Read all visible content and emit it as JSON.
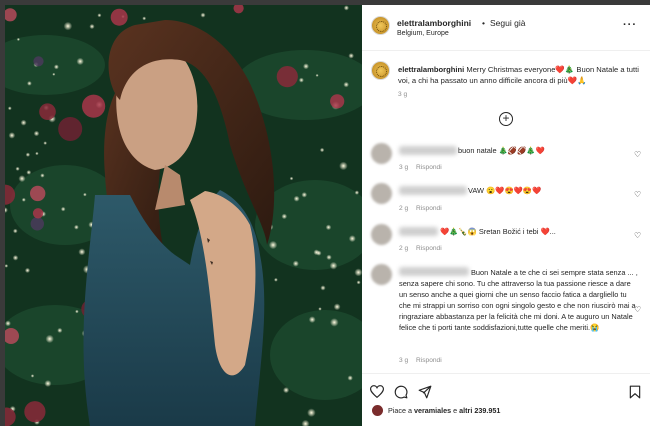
{
  "close_icon": "close-icon",
  "post": {
    "username": "elettralamborghini",
    "follow_label": "Segui già",
    "separator": "•",
    "location": "Belgium, Europe",
    "more": "···"
  },
  "caption": {
    "username": "elettralamborghini",
    "text": "Merry Christmas everyone❤️🎄 Buon Natale a tutti voi, a chi ha passato un anno difficile ancora di più❤️🙏",
    "time": "3 g"
  },
  "load_more_icon": "plus-circle-icon",
  "comments": [
    {
      "text": "buon natale 🎄🏈🏈🎄❤️",
      "time": "3 g",
      "reply": "Rispondi"
    },
    {
      "text": "VAW 😮❤️😍❤️😍❤️",
      "time": "2 g",
      "reply": "Rispondi"
    },
    {
      "text": "❤️🎄🍾😱 Sretan Božić i tebi ❤️...",
      "time": "2 g",
      "reply": "Rispondi"
    },
    {
      "text": "Buon Natale a te che ci sei sempre stata senza ... , senza sapere chi sono. Tu che attraverso la tua passione riesce a dare un senso anche a quei giorni che un senso faccio fatica a dargliello tu che mi strappi un sorriso con ogni singolo gesto e che non riuscirò mai a ringraziare abbastanza per la felicità che mi doni. A te auguro un Natale felice che ti porti tante soddisfazioni,tutte quelle che meriti.😭",
      "time": "3 g",
      "reply": "Rispondi"
    }
  ],
  "actions": {
    "like_icon": "heart-icon",
    "comment_icon": "comment-icon",
    "share_icon": "send-icon",
    "save_icon": "bookmark-icon"
  },
  "likes": {
    "prefix": "Piace a",
    "user": "veramiales",
    "middle": "e",
    "others": "altri 239.951"
  }
}
